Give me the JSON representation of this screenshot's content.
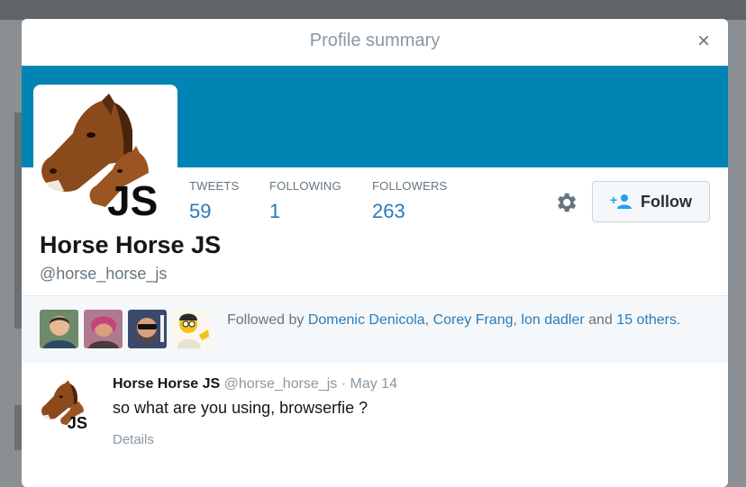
{
  "modal": {
    "title": "Profile summary",
    "close_label": "×"
  },
  "profile": {
    "name": "Horse Horse JS",
    "handle": "@horse_horse_js",
    "avatar_text": "JS",
    "stats": [
      {
        "label": "TWEETS",
        "value": "59"
      },
      {
        "label": "FOLLOWING",
        "value": "1"
      },
      {
        "label": "FOLLOWERS",
        "value": "263"
      }
    ],
    "follow_label": "Follow",
    "settings_icon": "gear-icon",
    "follow_icon": "add-user-icon"
  },
  "followed_by": {
    "prefix": "Followed by",
    "users": [
      "Domenic Denicola",
      "Corey Frang",
      "lon dadler"
    ],
    "sep1": ",",
    "sep2": ",",
    "and": "and",
    "others": "15 others",
    "period": "."
  },
  "tweet": {
    "name": "Horse Horse JS",
    "handle": "@horse_horse_js",
    "dot": "·",
    "date": "May 14",
    "text": "so what are you using, browserfie ?",
    "details": "Details"
  },
  "colors": {
    "banner": "#0084b4",
    "link": "#2b7bb9",
    "muted": "#66757f"
  }
}
